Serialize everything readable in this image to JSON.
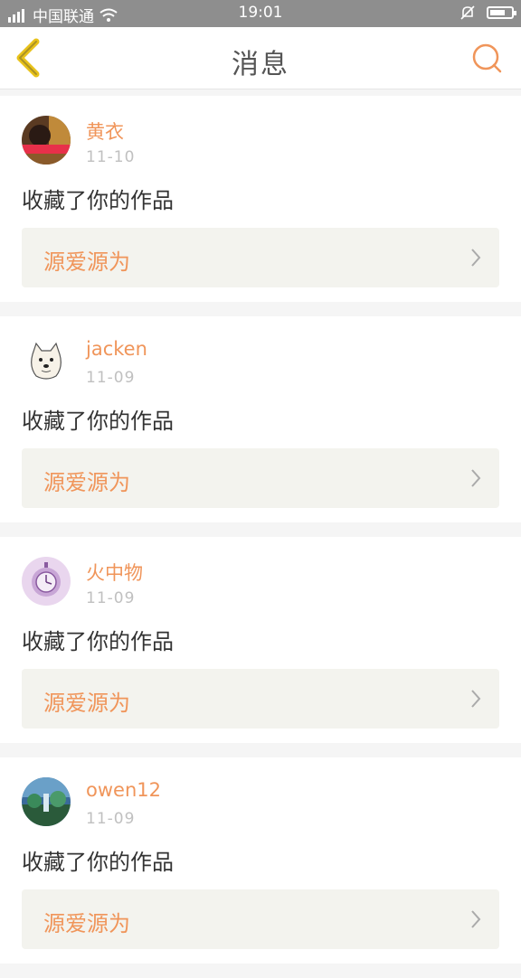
{
  "status_bar": {
    "carrier": "中国联通",
    "time": "19:01"
  },
  "nav": {
    "title": "消息"
  },
  "messages": [
    {
      "name": "黄衣",
      "date": "11-10",
      "action": "收藏了你的作品",
      "work": "源爱源为"
    },
    {
      "name": "jacken",
      "date": "11-09",
      "action": "收藏了你的作品",
      "work": "源爱源为"
    },
    {
      "name": "火中物",
      "date": "11-09",
      "action": "收藏了你的作品",
      "work": "源爱源为"
    },
    {
      "name": "owen12",
      "date": "11-09",
      "action": "收藏了你的作品",
      "work": "源爱源为"
    }
  ],
  "colors": {
    "accent": "#f0955a",
    "back_icon": "#e8c21a",
    "status_bar": "#8e8e8e"
  }
}
